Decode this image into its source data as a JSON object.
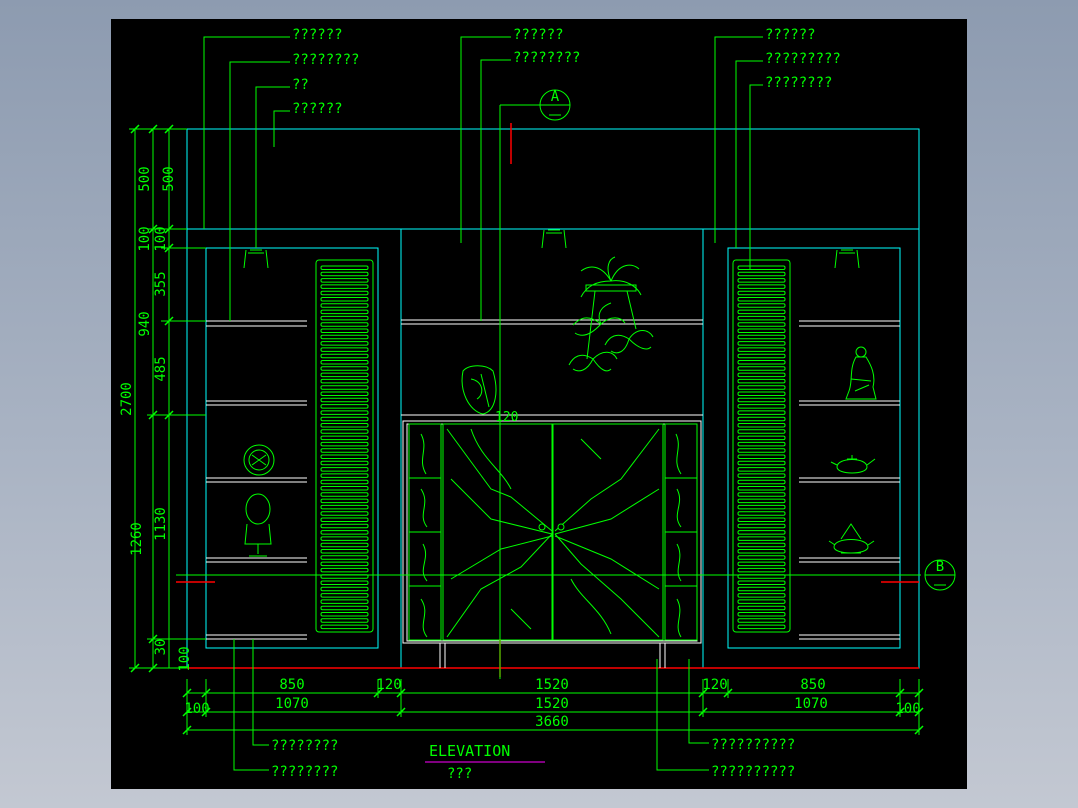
{
  "title": "ELEVATION",
  "subtitle": "???",
  "callouts": {
    "left": [
      "??????",
      "????????",
      "??",
      "??????"
    ],
    "center": [
      "??????",
      "????????"
    ],
    "right": [
      "??????",
      "?????????",
      "????????"
    ],
    "bottom_left": [
      "????????",
      "????????"
    ],
    "bottom_right": [
      "??????????",
      "??????????"
    ]
  },
  "section_marks": {
    "a": "A",
    "b": "B"
  },
  "dims_top_row": [
    "850",
    "120",
    "1520",
    "120",
    "850"
  ],
  "dims_mid_row": [
    "100",
    "1070",
    "1520",
    "1070",
    "100"
  ],
  "dims_total": "3660",
  "dims_left_outer": [
    "2700",
    "1260",
    "100"
  ],
  "dims_left_inner": [
    "500",
    "100",
    "940",
    "1130",
    "30"
  ],
  "dims_left_shelf": [
    "500",
    "100",
    "355",
    "485"
  ],
  "door_mark": "120",
  "colors": {
    "background": "#000000",
    "lines_cyan": "#00ffff",
    "annot_green": "#00ff00",
    "shelves_white": "#ffffff",
    "accent_red": "#ff0000",
    "underline_magenta": "#ff00ff"
  }
}
